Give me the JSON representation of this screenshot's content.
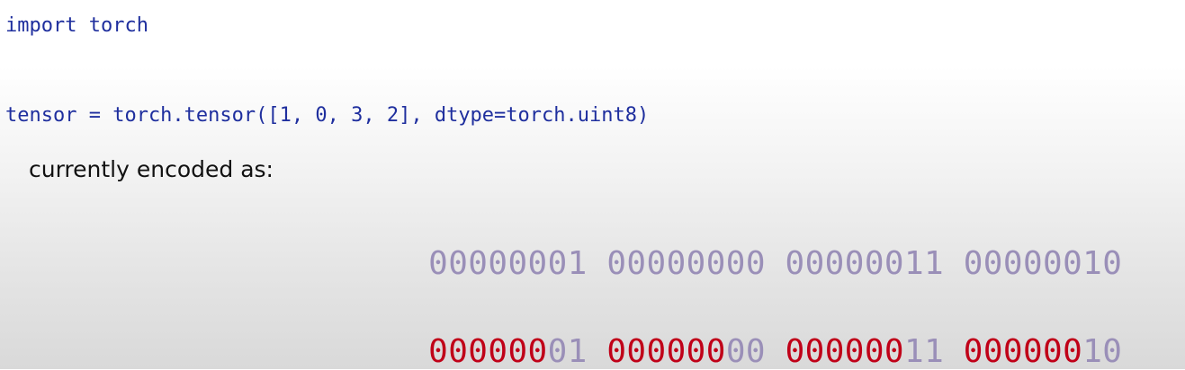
{
  "code": {
    "line1": "import torch",
    "line2": "tensor = torch.tensor([1, 0, 3, 2], dtype=torch.uint8)"
  },
  "caption": "currently encoded as:",
  "bytes": [
    "00000001",
    "00000000",
    "00000011",
    "00000010"
  ],
  "highlighted_bytes": [
    {
      "high": "000000",
      "low": "01"
    },
    {
      "high": "000000",
      "low": "00"
    },
    {
      "high": "000000",
      "low": "11"
    },
    {
      "high": "000000",
      "low": "10"
    }
  ],
  "colors": {
    "code_text": "#1f2f9e",
    "caption_text": "#111111",
    "bits_muted": "#9a8fb8",
    "bits_highlight": "#c00018"
  }
}
